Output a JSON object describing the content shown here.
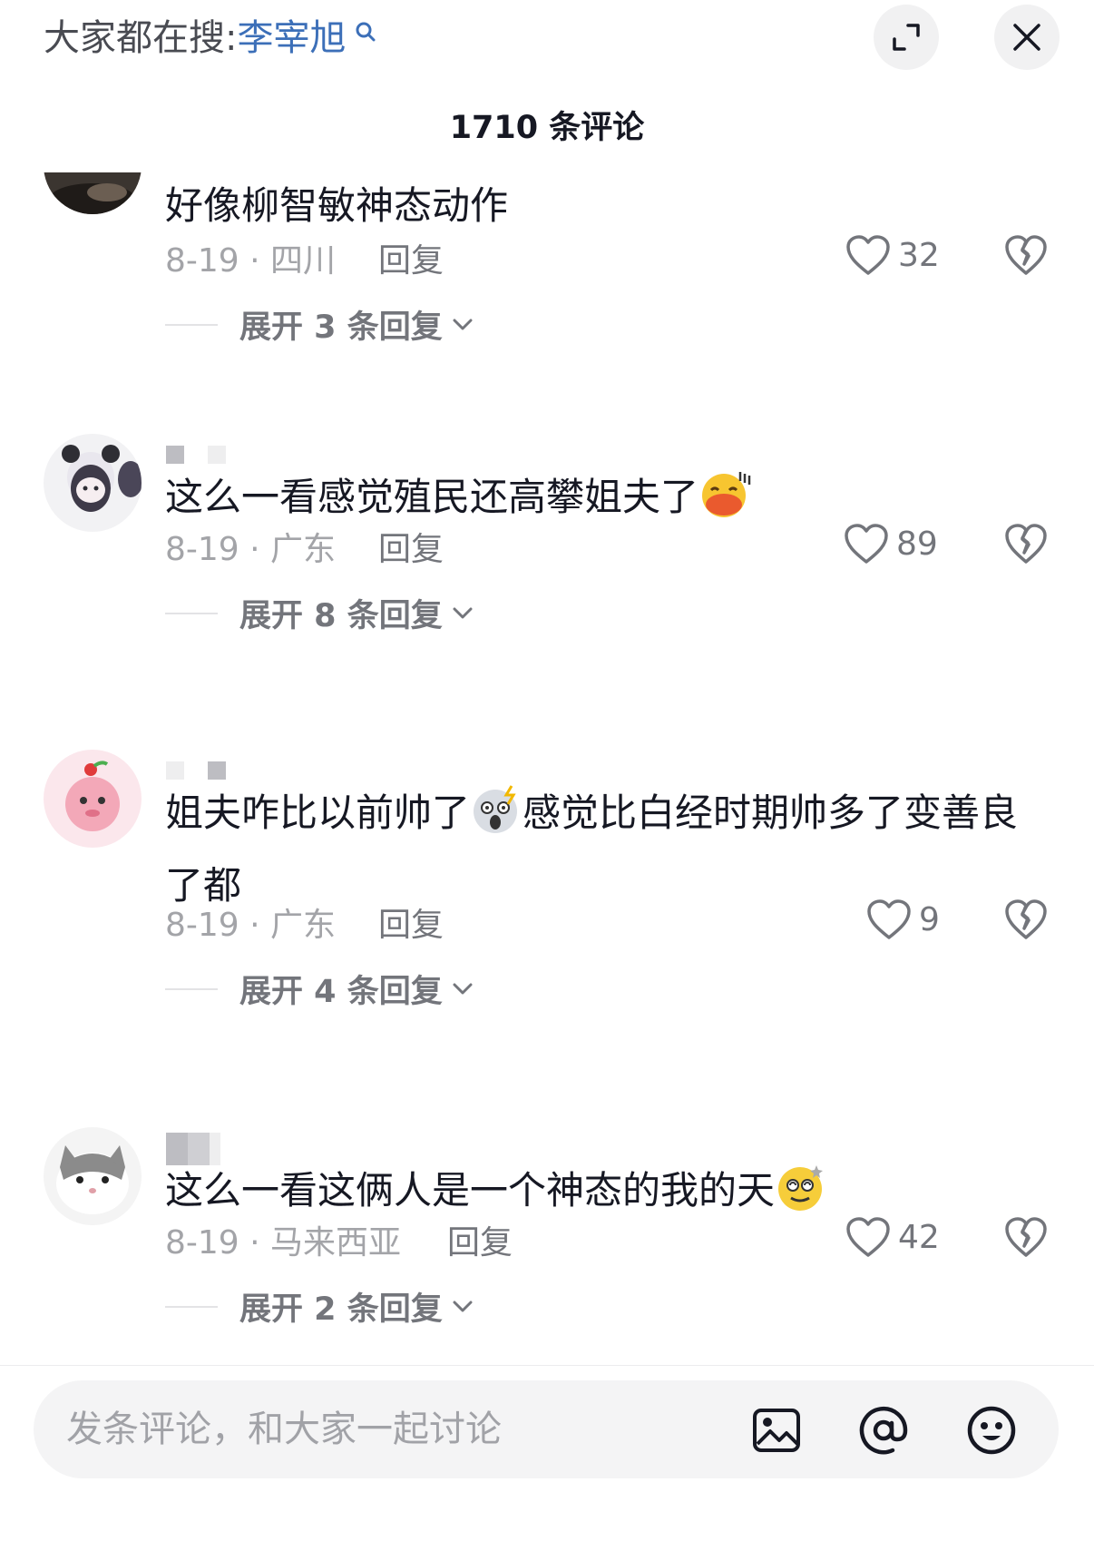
{
  "header": {
    "search_prefix": "大家都在搜:",
    "search_keyword": "李宰旭",
    "search_icon": "search-icon",
    "expand_icon": "expand-icon",
    "close_icon": "close-icon"
  },
  "comment_count_title": "1710 条评论",
  "comments": [
    {
      "text": "好像柳智敏神态动作",
      "date": "8-19",
      "location": "四川",
      "reply_label": "回复",
      "likes": "32",
      "expand_label": "展开 3 条回复"
    },
    {
      "text": "这么一看感觉殖民还高攀姐夫了",
      "emoji": "kissing-face-emoji",
      "date": "8-19",
      "location": "广东",
      "reply_label": "回复",
      "likes": "89",
      "expand_label": "展开 8 条回复"
    },
    {
      "text_before_emoji": "姐夫咋比以前帅了",
      "emoji": "shocked-face-emoji",
      "text_after_emoji": "感觉比白经时期帅多了变善良了都",
      "date": "8-19",
      "location": "广东",
      "reply_label": "回复",
      "likes": "9",
      "expand_label": "展开 4 条回复"
    },
    {
      "text": "这么一看这俩人是一个神态的我的天",
      "emoji": "dizzy-face-emoji",
      "date": "8-19",
      "location": "马来西亚",
      "reply_label": "回复",
      "likes": "42",
      "expand_label": "展开 2 条回复"
    }
  ],
  "input": {
    "placeholder": "发条评论，和大家一起讨论",
    "icons": [
      "image-icon",
      "at-icon",
      "emoji-icon"
    ]
  },
  "colors": {
    "keyword": "#3c6fb8",
    "text": "#161823",
    "secondary": "#73757b",
    "meta": "#a3a4a8",
    "background": "#ffffff"
  }
}
